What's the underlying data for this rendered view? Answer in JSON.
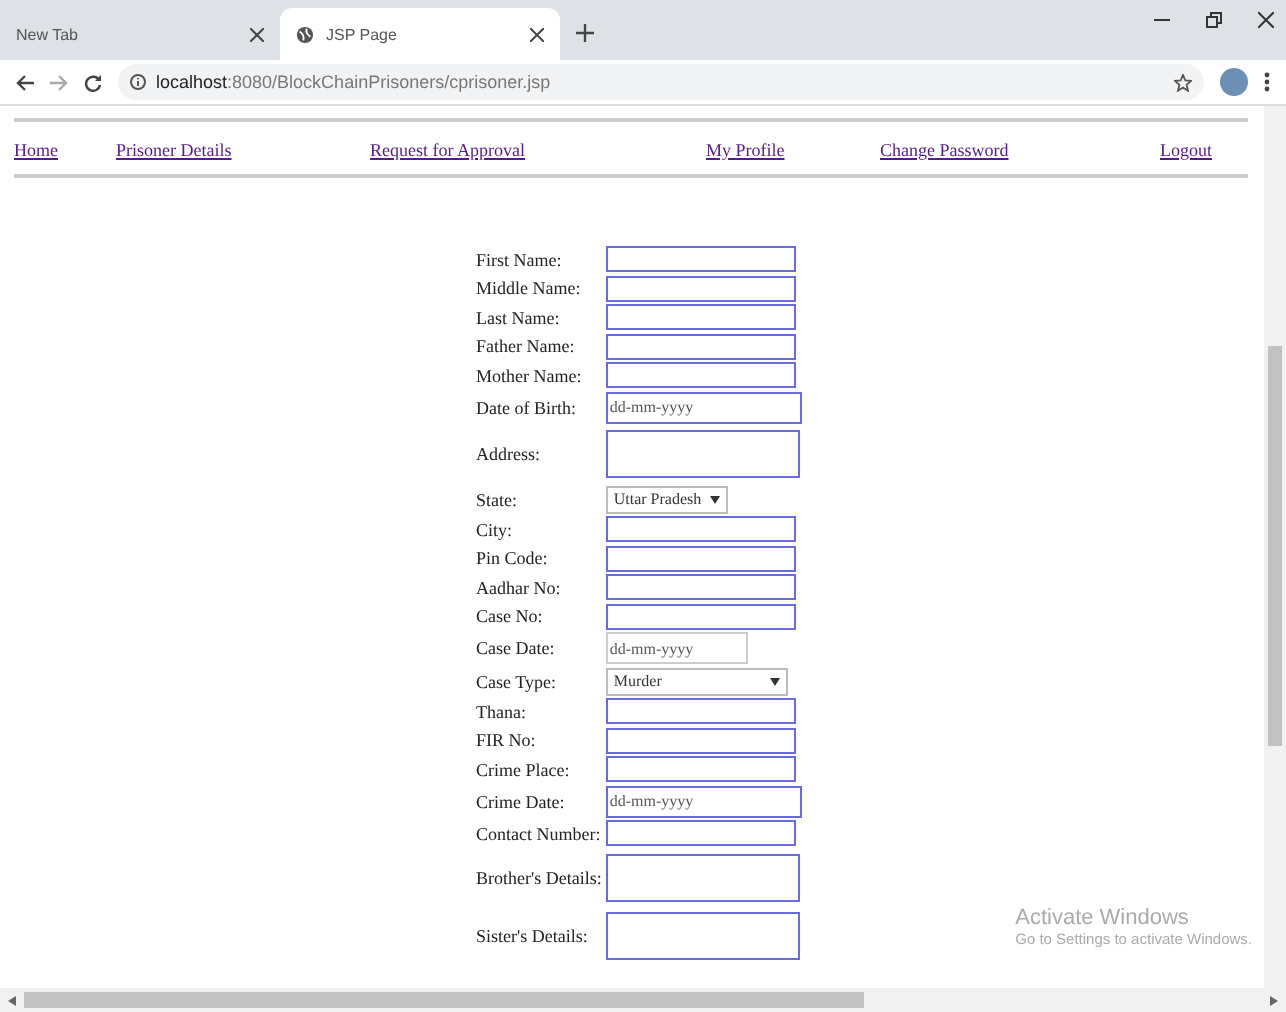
{
  "browser": {
    "tabs": [
      {
        "title": "New Tab",
        "selected": false
      },
      {
        "title": "JSP Page",
        "selected": true
      }
    ],
    "address": {
      "host": "localhost",
      "path": ":8080/BlockChainPrisoners/cprisoner.jsp"
    }
  },
  "nav": [
    "Home",
    "Prisoner Details",
    "Request for Approval",
    "My Profile",
    "Change Password",
    "Logout"
  ],
  "form": [
    {
      "label": "First Name:",
      "kind": "text"
    },
    {
      "label": "Middle Name:",
      "kind": "text"
    },
    {
      "label": "Last Name:",
      "kind": "text"
    },
    {
      "label": "Father Name:",
      "kind": "text"
    },
    {
      "label": "Mother Name:",
      "kind": "text"
    },
    {
      "label": "Date of Birth:",
      "kind": "date",
      "placeholder": "dd-mm-yyyy"
    },
    {
      "label": "Address:",
      "kind": "textarea"
    },
    {
      "label": "State:",
      "kind": "select",
      "value": "Uttar Pradesh"
    },
    {
      "label": "City:",
      "kind": "text"
    },
    {
      "label": "Pin Code:",
      "kind": "text"
    },
    {
      "label": "Aadhar No:",
      "kind": "text"
    },
    {
      "label": "Case No:",
      "kind": "text"
    },
    {
      "label": "Case Date:",
      "kind": "date-short",
      "placeholder": "dd-mm-yyyy"
    },
    {
      "label": "Case Type:",
      "kind": "select-wide",
      "value": "Murder"
    },
    {
      "label": "Thana:",
      "kind": "text"
    },
    {
      "label": "FIR No:",
      "kind": "text"
    },
    {
      "label": "Crime Place:",
      "kind": "text"
    },
    {
      "label": "Crime Date:",
      "kind": "date",
      "placeholder": "dd-mm-yyyy"
    },
    {
      "label": "Contact Number:",
      "kind": "text"
    },
    {
      "label": "Brother's Details:",
      "kind": "textarea"
    },
    {
      "label": "Sister's Details:",
      "kind": "textarea"
    }
  ],
  "os_notice": {
    "title": "Activate Windows",
    "text": "Go to Settings to activate Windows."
  }
}
